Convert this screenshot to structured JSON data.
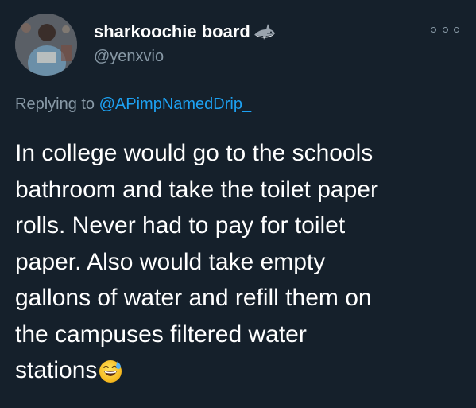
{
  "author": {
    "display_name": "sharkoochie board",
    "badge_icon": "shark-icon",
    "handle": "@yenxvio",
    "avatar_icon": "avatar-photo"
  },
  "actions": {
    "more_icon": "more-options-icon"
  },
  "reply": {
    "prefix": "Replying to ",
    "mention": "@APimpNamedDrip_"
  },
  "tweet": {
    "lines": [
      "In college would go to the schools",
      "bathroom and take the toilet paper",
      "rolls. Never had to pay for toilet",
      "paper. Also would take empty",
      "gallons of water and refill them on",
      "the campuses filtered water",
      "stations"
    ],
    "trailing_emoji": "grinning-face-with-sweat-emoji"
  },
  "colors": {
    "background": "#15202b",
    "primary_text": "#ffffff",
    "secondary_text": "#8899a6",
    "link": "#1da1f2"
  }
}
